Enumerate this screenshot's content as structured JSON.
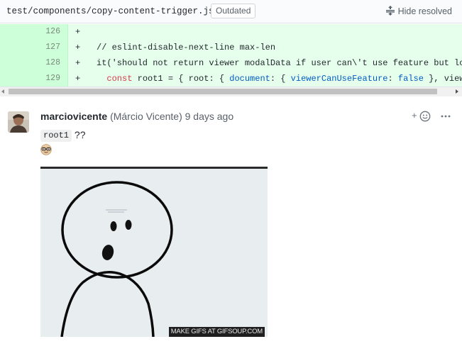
{
  "file_header": {
    "path": "test/components/copy-content-trigger.js",
    "badge": "Outdated",
    "hide_resolved_label": "Hide resolved",
    "hide_resolved_icon": "unfold-icon"
  },
  "diff": {
    "added_bg": "#e6ffed",
    "lines": [
      {
        "number": "126",
        "marker": "+"
      },
      {
        "number": "127",
        "marker": "+",
        "comment": "// eslint-disable-next-line max-len"
      },
      {
        "number": "128",
        "marker": "+",
        "text": "it('should not return viewer modalData if user can\\'t use feature but lo"
      },
      {
        "number": "129",
        "marker": "+",
        "indent": "  ",
        "kw": "const",
        "text_a": " root1 = { root: { ",
        "prop_a": "document",
        "text_b": ": { ",
        "prop_b": "viewerCanUseFeature",
        "text_c": ": ",
        "kw_false": "false",
        "text_d": " }, view"
      }
    ]
  },
  "comment": {
    "author_login": "marciovicente",
    "author_name": "(Márcio Vicente)",
    "timestamp": "9 days ago",
    "add_reaction_icon": "smiley-icon",
    "add_reaction_plus": "+",
    "more_icon": "kebab-horizontal-icon",
    "body_code": "root1",
    "body_text": " ??",
    "body_emoji": "nerd-face-emoji",
    "image_caption": "MAKE GIFS AT GIFSOUP.COM"
  }
}
